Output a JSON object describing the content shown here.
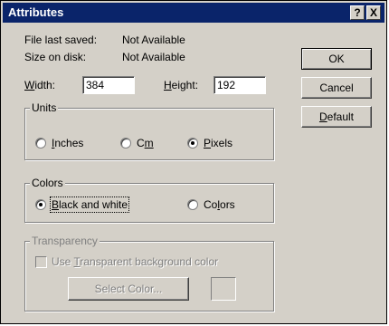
{
  "window": {
    "title": "Attributes",
    "help_glyph": "?",
    "close_glyph": "X"
  },
  "info": {
    "last_saved_label": "File last saved:",
    "last_saved_value": "Not Available",
    "size_label": "Size on disk:",
    "size_value": "Not Available"
  },
  "dimensions": {
    "width_label_first": "W",
    "width_label_rest": "idth:",
    "width_value": "384",
    "height_label_first": "H",
    "height_label_rest": "eight:",
    "height_value": "192"
  },
  "units": {
    "title": "Units",
    "inches_first": "I",
    "inches_rest": "nches",
    "cm_first": "C",
    "cm_u": "m",
    "pixels_first": "P",
    "pixels_rest": "ixels",
    "selected": "Pixels"
  },
  "colors": {
    "title": "Colors",
    "bw_first": "B",
    "bw_rest": "lack and white",
    "colors_pre": "Co",
    "colors_u": "l",
    "colors_post": "ors",
    "selected": "Black and white"
  },
  "transparency": {
    "title": "Transparency",
    "checkbox_pre": "Use ",
    "checkbox_u": "T",
    "checkbox_post": "ransparent background color",
    "select_color_label": "Select Color..."
  },
  "buttons": {
    "ok": "OK",
    "cancel": "Cancel",
    "default_first": "D",
    "default_rest": "efault"
  },
  "theme": {
    "titlebar": "#0a246a",
    "face": "#d4d0c8"
  }
}
